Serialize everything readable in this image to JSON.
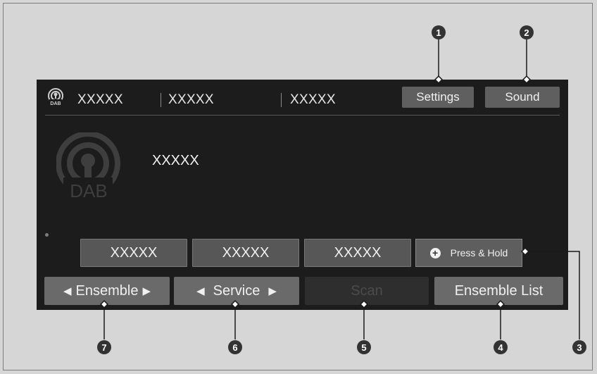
{
  "status_bar": {
    "items": [
      "XXXXX",
      "XXXXX",
      "XXXXX"
    ],
    "icon": "dab-radio-icon",
    "icon_label": "DAB"
  },
  "buttons": {
    "settings": "Settings",
    "sound": "Sound",
    "ensemble": "Ensemble",
    "service": "Service",
    "scan": "Scan",
    "ensemble_list": "Ensemble List",
    "press_hold": "Press & Hold"
  },
  "station": {
    "name": "XXXXX",
    "logo_label": "DAB"
  },
  "presets": [
    "XXXXX",
    "XXXXX",
    "XXXXX"
  ],
  "callouts": [
    "1",
    "2",
    "3",
    "4",
    "5",
    "6",
    "7"
  ],
  "colors": {
    "screen_bg": "#1c1c1c",
    "button_bg": "#5f5f5f",
    "page_bg": "#d6d6d6",
    "callout_bg": "#333333"
  }
}
